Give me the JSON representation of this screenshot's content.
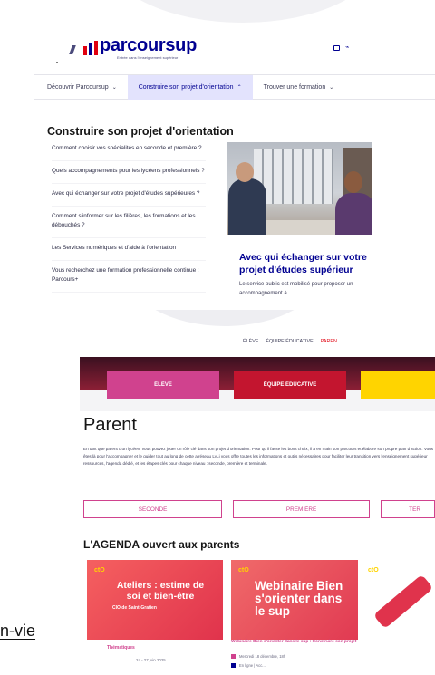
{
  "header": {
    "logo_text": "parcoursup",
    "logo_tagline": "Entrée dans l'enseignement supérieur"
  },
  "nav": {
    "items": [
      {
        "label": "Découvrir Parcoursup"
      },
      {
        "label": "Construire son projet d'orientation"
      },
      {
        "label": "Trouver une formation"
      }
    ],
    "active_index": 1
  },
  "menu": {
    "heading": "Construire son projet d'orientation",
    "links": [
      "Comment choisir vos spécialités en seconde et première ?",
      "Quels accompagnements pour les lycéens professionnels ?",
      "Avec qui échanger sur votre projet d'études supérieures ?",
      "Comment s'informer sur les filières, les formations et les débouchés ?",
      "Les Services numériques et d'aide à l'orientation",
      "Vous recherchez une formation professionnelle continue : Parcours+"
    ],
    "card": {
      "title": "Avec qui échanger sur votre projet d'études supérieur",
      "text": "Le service public est mobilisé pour proposer un accompagnement à"
    }
  },
  "parent_page": {
    "top_links": [
      "ÉLÈVE",
      "ÉQUIPE ÉDUCATIVE",
      "PAREN..."
    ],
    "hero_buttons": [
      "ÉLÈVE",
      "ÉQUIPE ÉDUCATIVE"
    ],
    "title": "Parent",
    "intro": "En tant que parent d'un lycéen, vous pouvez jouer un rôle clé dans son projet d'orientation. Pour qu'il fasse les bons choix, il a en main son parcours et élabore son propre plan d'action. Vous êtes là pour l'accompagner et le guider tout au long de cette a réseau LyLi vous offre toutes les informations et outils nécessaires pour faciliter leur transition vers l'enseignement supérieur ressources, l'agenda dédié, et les étapes clés pour chaque niveau : seconde, première et terminale.",
    "level_tabs": [
      "SECONDE",
      "PREMIÈRE",
      "TER"
    ],
    "agenda_heading": "L'AGENDA ouvert aux parents",
    "events": [
      {
        "badge": "ctO",
        "title": "Ateliers : estime de soi et bien-être",
        "subtitle": "CIO de Saint-Gratien",
        "info": "Thématiques",
        "date": "24 - 27 juin 2025"
      },
      {
        "badge": "ctO",
        "title": "Webinaire Bien s'orienter dans le sup",
        "info": "Webinaire Bien s'orienter dans le sup : Construire son projet",
        "date": "Mercredi 18 décembre, 18h",
        "location": "En ligne | Acc..."
      },
      {
        "badge": "ctO"
      }
    ]
  },
  "fragment": {
    "text": "n-vie"
  }
}
